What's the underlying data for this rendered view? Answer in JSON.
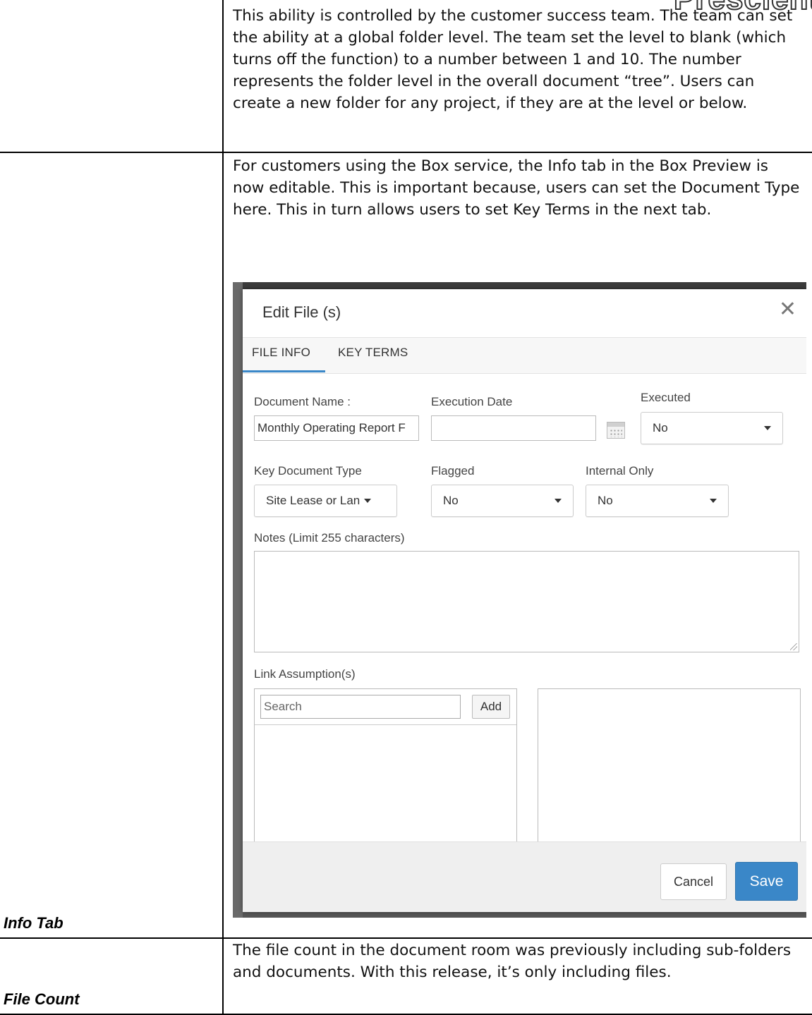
{
  "header_logo_fragment": "Prescient",
  "rows": [
    {
      "label": "",
      "text": "This ability is controlled by the customer success team.  The team can set the ability at a global folder level.  The team set the level to blank (which turns off the function) to a number between 1 and 10.  The number represents the folder level in the overall document “tree”.  Users can create a new folder for any project, if they are at the level or below."
    },
    {
      "label": "Info Tab",
      "text": "For customers using the Box service, the Info tab in the Box Preview is now editable.  This is important because, users can set the Document Type here.  This in turn allows users to set Key Terms in the next tab."
    },
    {
      "label": "File Count",
      "text": "The file count in the document room was previously including sub-folders and documents.  With this release, it’s only including files."
    }
  ],
  "dialog": {
    "title": "Edit File (s)",
    "close_icon": "close-icon",
    "tabs": [
      {
        "label": "FILE INFO",
        "active": true
      },
      {
        "label": "KEY TERMS",
        "active": false
      }
    ],
    "fields": {
      "document_name": {
        "label": "Document Name :",
        "value": "Monthly Operating Report F"
      },
      "execution_date": {
        "label": "Execution Date",
        "value": "",
        "icon": "calendar-icon"
      },
      "executed": {
        "label": "Executed",
        "value": "No"
      },
      "key_document_type": {
        "label": "Key Document Type",
        "value": "Site Lease or Lan"
      },
      "flagged": {
        "label": "Flagged",
        "value": "No"
      },
      "internal_only": {
        "label": "Internal Only",
        "value": "No"
      },
      "notes": {
        "label": "Notes (Limit 255 characters)",
        "value": ""
      },
      "link_assumptions": {
        "label": "Link Assumption(s)",
        "search_placeholder": "Search",
        "add_label": "Add"
      }
    },
    "buttons": {
      "cancel": "Cancel",
      "save": "Save"
    }
  },
  "colors": {
    "primary_button": "#3a87c8",
    "active_tab_underline": "#3a87c8",
    "footer_background": "#efefef",
    "tab_bar_background": "#f7f7f7"
  }
}
